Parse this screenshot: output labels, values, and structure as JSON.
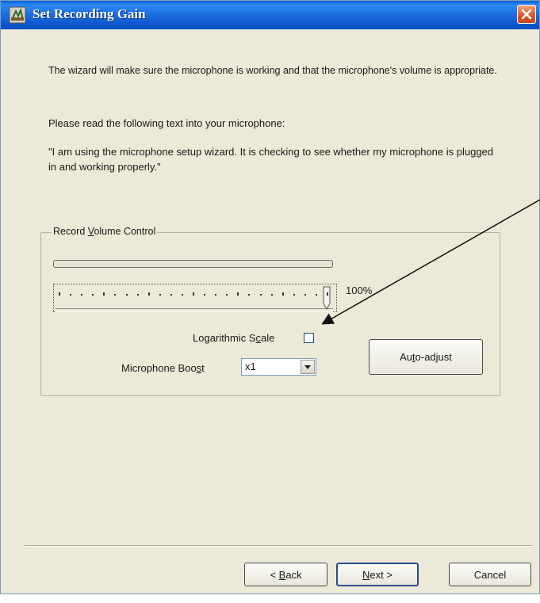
{
  "window": {
    "title": "Set Recording Gain"
  },
  "intro": {
    "text": "The wizard will make sure the microphone is working and that the microphone's volume is appropriate.",
    "instruction": "Please read the following text into your microphone:",
    "quote": "\"I am using the microphone setup wizard. It is checking to see whether my microphone is plugged in and working properly.\""
  },
  "volume_group": {
    "label_pre": "Record ",
    "label_mnemonic": "V",
    "label_post": "olume Control",
    "slider_level": 1.0,
    "percent_label": "100%",
    "log_scale_pre": "Logarithmic S",
    "log_scale_mnemonic": "c",
    "log_scale_post": "ale",
    "log_scale_checked": false,
    "boost_label_pre": "Microphone Boo",
    "boost_label_mnemonic": "s",
    "boost_label_post": "t",
    "boost_value": "x1",
    "auto_adjust_pre": "Au",
    "auto_adjust_mnemonic": "t",
    "auto_adjust_post": "o-adjust"
  },
  "footer": {
    "back_pre": "< ",
    "back_mnemonic": "B",
    "back_post": "ack",
    "next_mnemonic": "N",
    "next_post": "ext >",
    "cancel_label": "Cancel"
  },
  "colors": {
    "dialog_background": "#ece9d8",
    "titlebar_blue": "#1f6fe0",
    "close_button_red": "#d9552b"
  }
}
